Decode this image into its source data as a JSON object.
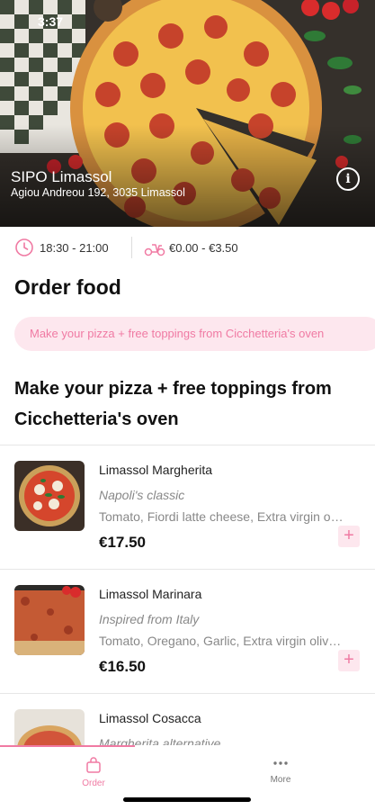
{
  "status_bar": {
    "time": "3:37"
  },
  "store": {
    "name": "SIPO Limassol",
    "address": "Agiou Andreou 192, 3035 Limassol"
  },
  "meta": {
    "hours": "18:30 - 21:00",
    "delivery_fee": "€0.00 - €3.50"
  },
  "page_title": "Order food",
  "category_chip": "Make your pizza + free toppings from Cicchetteria's oven",
  "section_title": "Make your pizza + free toppings from Cicchetteria's oven",
  "menu_items": [
    {
      "name": "Limassol Margherita",
      "subtitle": "Napoli's classic",
      "description": "Tomato, Fiordi latte cheese, Extra virgin olive oil, Basil",
      "price": "€17.50"
    },
    {
      "name": "Limassol Marinara",
      "subtitle": "Inspired from Italy",
      "description": "Tomato, Oregano, Garlic, Extra virgin olive oil",
      "price": "€16.50"
    },
    {
      "name": "Limassol Cosacca",
      "subtitle": "Margherita alternative",
      "description": "",
      "price": ""
    }
  ],
  "add_symbol": "+",
  "tabbar": {
    "order_label": "Order",
    "more_label": "More"
  },
  "colors": {
    "accent": "#f07aa3",
    "accent_light": "#fde7ee"
  }
}
